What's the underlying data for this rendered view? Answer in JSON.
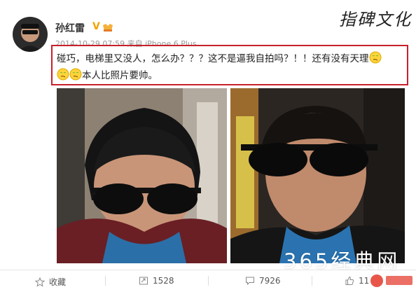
{
  "post": {
    "author": "孙红雷",
    "verified_mark": "V",
    "meta": "2014-10-29 07:59 来自 iPhone 6 Plus",
    "text_line1": "碰巧，电梯里又没人，怎么办？？？这不是逼我自拍吗？！！还有没有天理",
    "text_line2": "本人比照片要帅。",
    "emoji_count": 3
  },
  "watermark": {
    "brand": "指碑文化",
    "site": "365经典网"
  },
  "actions": {
    "favorite_label": "收藏",
    "repost_count": "1528",
    "comment_count": "7926",
    "like_count": "11"
  },
  "colors": {
    "highlight_border": "#c8202a",
    "verified": "#f2a300",
    "corner_logo": "#e8564a"
  }
}
